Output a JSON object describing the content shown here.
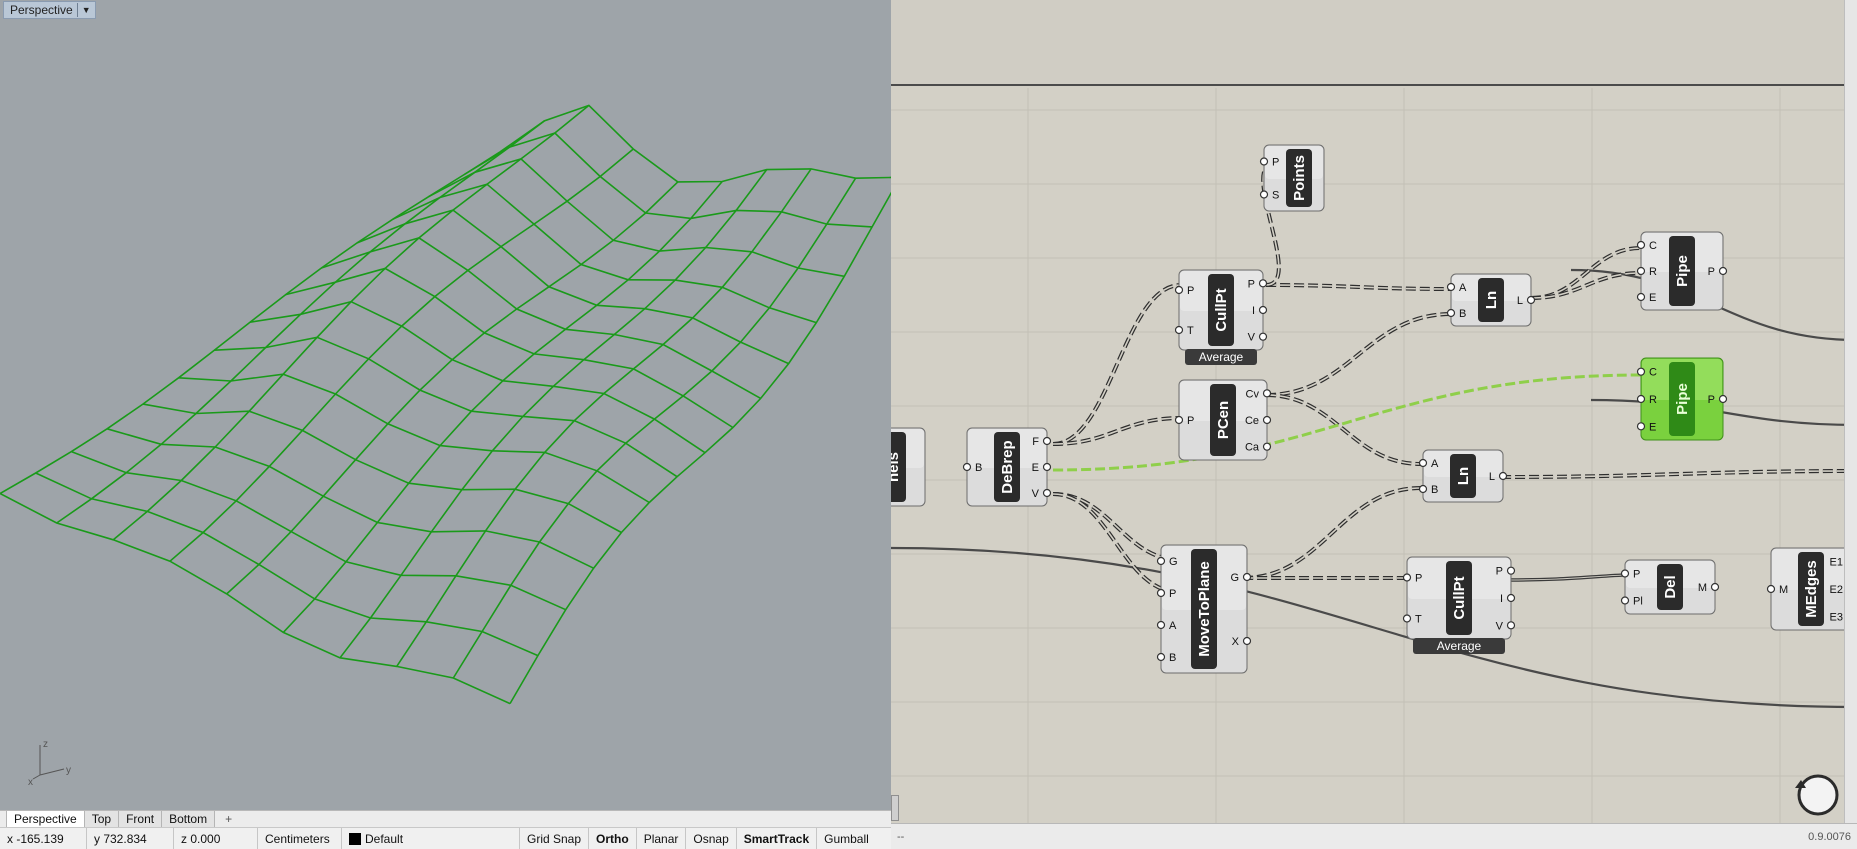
{
  "viewport": {
    "title": "Perspective",
    "axis": {
      "z": "z",
      "y": "y",
      "x": "x"
    },
    "tabs": [
      "Perspective",
      "Top",
      "Front",
      "Bottom"
    ],
    "add_tab_symbol": "+",
    "mesh_color": "#1a9a1a"
  },
  "statusbar": {
    "x": "x -165.139",
    "y": "y 732.834",
    "z": "z 0.000",
    "units": "Centimeters",
    "layer": "Default",
    "toggles": [
      "Grid Snap",
      "Ortho",
      "Planar",
      "Osnap",
      "SmartTrack",
      "Gumball"
    ],
    "bold_toggles": [
      "Ortho",
      "SmartTrack"
    ]
  },
  "grasshopper": {
    "nodes": {
      "panels": {
        "title": "nels"
      },
      "debrep": {
        "title": "DeBrep",
        "inputs": [
          "B"
        ],
        "outputs": [
          "F",
          "E",
          "V"
        ]
      },
      "points": {
        "title": "Points",
        "inputs": [
          "P",
          "S"
        ]
      },
      "cullpt1": {
        "title": "CullPt",
        "inputs": [
          "P",
          "T"
        ],
        "outputs": [
          "P",
          "I",
          "V"
        ],
        "footer": "Average"
      },
      "pcen": {
        "title": "PCen",
        "inputs": [
          "P"
        ],
        "outputs": [
          "Cv",
          "Ce",
          "Ca"
        ]
      },
      "ln1": {
        "title": "Ln",
        "inputs": [
          "A",
          "B"
        ],
        "outputs": [
          "L"
        ]
      },
      "ln2": {
        "title": "Ln",
        "inputs": [
          "A",
          "B"
        ],
        "outputs": [
          "L"
        ]
      },
      "pipe1": {
        "title": "Pipe",
        "inputs": [
          "C",
          "R",
          "E"
        ],
        "outputs": [
          "P"
        ]
      },
      "pipe2": {
        "title": "Pipe",
        "inputs": [
          "C",
          "R",
          "E"
        ],
        "outputs": [
          "P"
        ]
      },
      "movetoplane": {
        "title": "MoveToPlane",
        "inputs": [
          "G",
          "P",
          "A",
          "B"
        ],
        "outputs": [
          "G",
          "X"
        ]
      },
      "cullpt2": {
        "title": "CullPt",
        "inputs": [
          "P",
          "T"
        ],
        "outputs": [
          "P",
          "I",
          "V"
        ],
        "footer": "Average"
      },
      "del": {
        "title": "Del",
        "inputs": [
          "P",
          "Pl"
        ],
        "outputs": [
          "M"
        ]
      },
      "medges": {
        "title": "MEdges",
        "inputs": [
          "M"
        ],
        "outputs": [
          "E1",
          "E2",
          "E3"
        ]
      }
    },
    "version": "0.9.0076",
    "bottom_left": "--"
  }
}
